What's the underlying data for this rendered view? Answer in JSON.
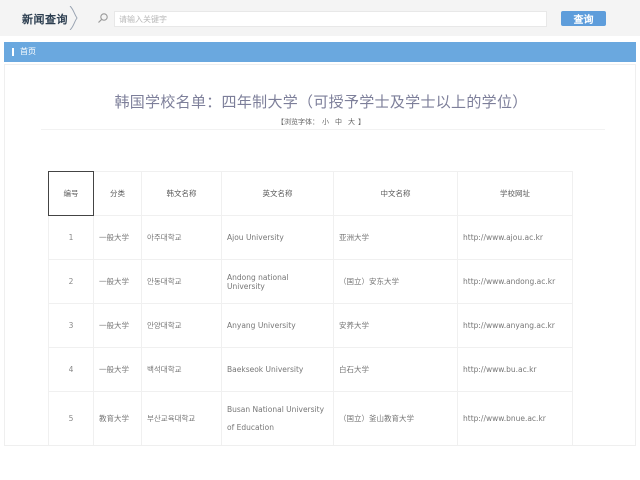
{
  "header": {
    "site_name": "新闻查询",
    "search_placeholder": "请输入关键字",
    "search_button": "查询"
  },
  "breadcrumb": {
    "home": "首页"
  },
  "page": {
    "title": "韩国学校名单：四年制大学（可授予学士及学士以上的学位）",
    "font_label": "【浏览字体：",
    "font_small": "小",
    "font_medium": "中",
    "font_large": "大",
    "font_close": "】"
  },
  "table": {
    "headers": [
      "编号",
      "分类",
      "韩文名称",
      "英文名称",
      "中文名称",
      "学校网址"
    ],
    "rows": [
      [
        "1",
        "一般大学",
        "아주대학교",
        "Ajou  University",
        "亚洲大学",
        "http://www.ajou.ac.kr"
      ],
      [
        "2",
        "一般大学",
        "안동대학교",
        "Andong national  University",
        "（国立）安东大学",
        "http://www.andong.ac.kr"
      ],
      [
        "3",
        "一般大学",
        "안양대학교",
        "Anyang  University",
        "安养大学",
        "http://www.anyang.ac.kr"
      ],
      [
        "4",
        "一般大学",
        "백석대학교",
        "Baekseok  University",
        "白石大学",
        "http://www.bu.ac.kr"
      ],
      [
        "5",
        "教育大学",
        "부산교육대학교",
        "Busan National  University of Education",
        "（国立）釜山教育大学",
        "http://www.bnue.ac.kr"
      ]
    ]
  },
  "colors": {
    "accent": "#5e9ddb",
    "navbar": "#6aa8df",
    "title": "#7d7f9a"
  }
}
